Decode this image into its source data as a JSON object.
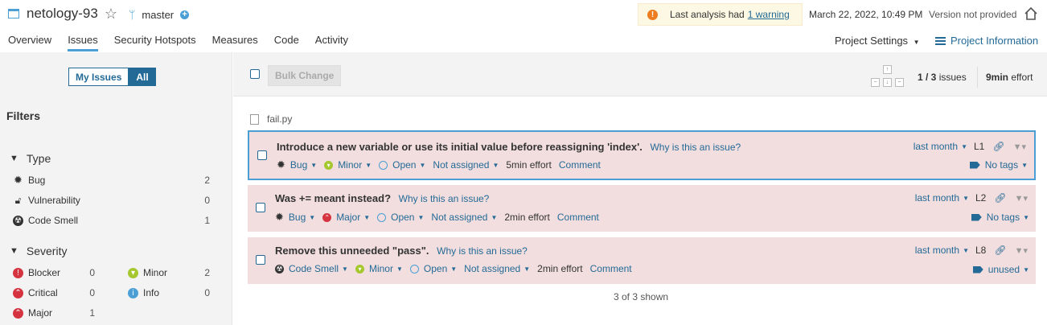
{
  "header": {
    "project_name": "netology-93",
    "branch": "master",
    "warning_text": "Last analysis had",
    "warning_link": "1 warning",
    "analysis_date": "March 22, 2022, 10:49 PM",
    "version": "Version not provided"
  },
  "nav": {
    "tabs": [
      "Overview",
      "Issues",
      "Security Hotspots",
      "Measures",
      "Code",
      "Activity"
    ],
    "active_tab": "Issues",
    "project_settings": "Project Settings",
    "project_information": "Project Information"
  },
  "sidebar": {
    "my_issues": "My Issues",
    "all": "All",
    "filters_title": "Filters",
    "type_title": "Type",
    "types": [
      {
        "label": "Bug",
        "count": "2",
        "icon": "bug-icon"
      },
      {
        "label": "Vulnerability",
        "count": "0",
        "icon": "lock-icon"
      },
      {
        "label": "Code Smell",
        "count": "1",
        "icon": "code-smell-icon"
      }
    ],
    "severity_title": "Severity",
    "severities": [
      {
        "label": "Blocker",
        "count": "0",
        "icon": "blocker-icon",
        "color": "#d4333f"
      },
      {
        "label": "Minor",
        "count": "2",
        "icon": "minor-icon",
        "color": "#a5c82e"
      },
      {
        "label": "Critical",
        "count": "0",
        "icon": "critical-icon",
        "color": "#d4333f"
      },
      {
        "label": "Info",
        "count": "0",
        "icon": "info-icon",
        "color": "#4b9fd5"
      },
      {
        "label": "Major",
        "count": "1",
        "icon": "major-icon",
        "color": "#d4333f"
      }
    ]
  },
  "toolbar": {
    "bulk_change": "Bulk Change",
    "issue_count": "1 / 3",
    "issues_word": "issues",
    "effort": "9min",
    "effort_word": "effort"
  },
  "file": {
    "name": "fail.py"
  },
  "issues": [
    {
      "message": "Introduce a new variable or use its initial value before reassigning 'index'.",
      "why": "Why is this an issue?",
      "type": "Bug",
      "severity": "Minor",
      "status": "Open",
      "assignee": "Not assigned",
      "effort": "5min effort",
      "comment": "Comment",
      "date": "last month",
      "line": "L1",
      "tags": "No tags"
    },
    {
      "message": "Was += meant instead?",
      "why": "Why is this an issue?",
      "type": "Bug",
      "severity": "Major",
      "status": "Open",
      "assignee": "Not assigned",
      "effort": "2min effort",
      "comment": "Comment",
      "date": "last month",
      "line": "L2",
      "tags": "No tags"
    },
    {
      "message": "Remove this unneeded \"pass\".",
      "why": "Why is this an issue?",
      "type": "Code Smell",
      "severity": "Minor",
      "status": "Open",
      "assignee": "Not assigned",
      "effort": "2min effort",
      "comment": "Comment",
      "date": "last month",
      "line": "L8",
      "tags": "unused"
    }
  ],
  "footer": {
    "shown": "3 of 3 shown"
  },
  "colors": {
    "accent": "#236a97",
    "issue_bg": "#f2dede",
    "selected_border": "#4b9fd5"
  }
}
